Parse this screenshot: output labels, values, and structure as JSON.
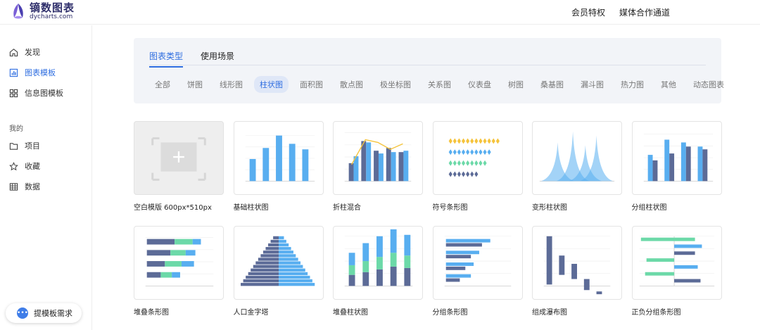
{
  "logo": {
    "name_cn": "镝数图表",
    "name_en": "dycharts.com"
  },
  "top_links": [
    "会员特权",
    "媒体合作通道"
  ],
  "sidebar": {
    "items": [
      {
        "label": "发现",
        "icon": "home-icon"
      },
      {
        "label": "图表模板",
        "icon": "bar-chart-icon"
      },
      {
        "label": "信息图模板",
        "icon": "grid-icon"
      }
    ],
    "section_title": "我的",
    "my_items": [
      {
        "label": "项目",
        "icon": "folder-icon"
      },
      {
        "label": "收藏",
        "icon": "star-icon"
      },
      {
        "label": "数据",
        "icon": "table-icon"
      }
    ],
    "request_button": "提模板需求"
  },
  "tabs": [
    "图表类型",
    "使用场景"
  ],
  "categories": [
    "全部",
    "饼图",
    "线形图",
    "柱状图",
    "面积图",
    "散点图",
    "极坐标图",
    "关系图",
    "仪表盘",
    "树图",
    "桑基图",
    "漏斗图",
    "热力图",
    "其他",
    "动态图表"
  ],
  "active_category": "柱状图",
  "templates": [
    {
      "label": "空白模版 600px*510px"
    },
    {
      "label": "基础柱状图"
    },
    {
      "label": "折柱混合"
    },
    {
      "label": "符号条形图"
    },
    {
      "label": "变形柱状图"
    },
    {
      "label": "分组柱状图"
    },
    {
      "label": "堆叠条形图"
    },
    {
      "label": "人口金字塔"
    },
    {
      "label": "堆叠柱状图"
    },
    {
      "label": "分组条形图"
    },
    {
      "label": "组成瀑布图"
    },
    {
      "label": "正负分组条形图"
    }
  ],
  "colors": {
    "accent": "#2f6ee0",
    "bar_blue": "#58aef0",
    "bar_navy": "#5c6b97",
    "bar_green": "#6cd9a8",
    "line_yellow": "#f5c33b"
  }
}
